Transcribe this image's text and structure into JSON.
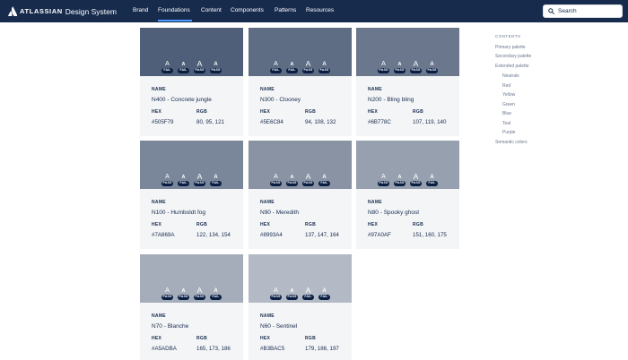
{
  "brand": {
    "name": "ATLASSIAN",
    "sub": "Design System"
  },
  "nav": {
    "items": [
      "Brand",
      "Foundations",
      "Content",
      "Components",
      "Patterns",
      "Resources"
    ],
    "active": "Foundations"
  },
  "search": {
    "label": "Search"
  },
  "labels": {
    "name": "NAME",
    "hex": "HEX",
    "rgb": "RGB"
  },
  "cards": [
    {
      "name": "N400 - Concrete jungle",
      "hex": "#505F79",
      "rgb": "80, 95, 121",
      "color": "#505F79",
      "badges": [
        "FAIL",
        "FAIL",
        "PASS",
        "PASS"
      ]
    },
    {
      "name": "N300 - Clooney",
      "hex": "#5E6C84",
      "rgb": "94, 108, 132",
      "color": "#5E6C84",
      "badges": [
        "FAIL",
        "FAIL",
        "PASS",
        "PASS"
      ]
    },
    {
      "name": "N200 - Bling bling",
      "hex": "#6B778C",
      "rgb": "107, 119, 140",
      "color": "#6B778C",
      "badges": [
        "PASS",
        "PASS",
        "PASS",
        "PASS"
      ]
    },
    {
      "name": "N100 - Humboldt fog",
      "hex": "#7A869A",
      "rgb": "122, 134, 154",
      "color": "#7A869A",
      "badges": [
        "PASS",
        "FAIL",
        "PASS",
        "FAIL"
      ]
    },
    {
      "name": "N90 - Meredith",
      "hex": "#8993A4",
      "rgb": "137, 147, 164",
      "color": "#8993A4",
      "badges": [
        "PASS",
        "PASS",
        "PASS",
        "FAIL"
      ]
    },
    {
      "name": "N80 - Spooky ghost",
      "hex": "#97A0AF",
      "rgb": "151, 160, 175",
      "color": "#97A0AF",
      "badges": [
        "PASS",
        "PASS",
        "PASS",
        "FAIL"
      ]
    },
    {
      "name": "N70 - Blanche",
      "hex": "#A5ADBA",
      "rgb": "165, 173, 186",
      "color": "#A5ADBA",
      "badges": [
        "PASS",
        "PASS",
        "PASS",
        "FAIL"
      ]
    },
    {
      "name": "N60 - Sentinel",
      "hex": "#B3BAC5",
      "rgb": "179, 186, 197",
      "color": "#B3BAC5",
      "badges": [
        "PASS",
        "PASS",
        "FAIL",
        "FAIL"
      ]
    }
  ],
  "toc": {
    "heading": "CONTENTS",
    "items": [
      "Primary palette",
      "Secondary palette",
      "Extended palette",
      "Neutrals",
      "Red",
      "Yellow",
      "Green",
      "Blue",
      "Teal",
      "Purple",
      "Semantic colors"
    ]
  },
  "colors": {
    "nav_bg": "#172B4D",
    "accent": "#4C9AFF",
    "card_bg": "#F4F5F7",
    "pill_bg": "#091E42"
  },
  "icons": {
    "logo": "atlassian-logo-icon",
    "search": "search-icon"
  }
}
